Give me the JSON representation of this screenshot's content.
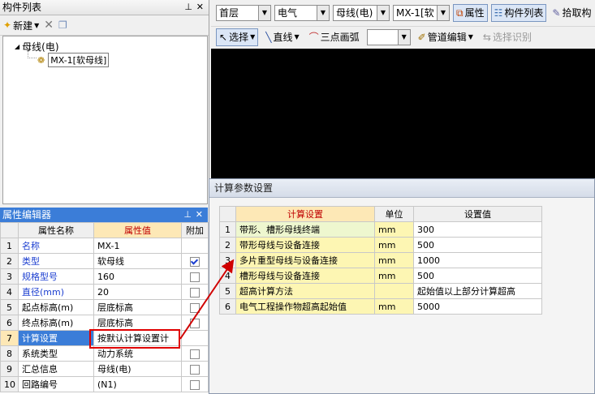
{
  "component_panel": {
    "title": "构件列表",
    "new_label": "新建",
    "tree_root": "母线(电)",
    "tree_child": "MX-1[软母线]"
  },
  "top_bar": {
    "floor": "首层",
    "specialty": "电气",
    "type": "母线(电)",
    "component": "MX-1[软",
    "properties_label": "属性",
    "component_list_label": "构件列表",
    "pick_label": "拾取构",
    "select_label": "选择",
    "line_label": "直线",
    "arc_label": "三点画弧",
    "pipe_edit_label": "管道编辑",
    "select_identify_label": "选择识别"
  },
  "property_editor": {
    "title": "属性编辑器",
    "headers": {
      "name": "属性名称",
      "value": "属性值",
      "extra": "附加"
    },
    "rows": [
      {
        "num": "1",
        "name": "名称",
        "value": "MX-1",
        "blue": true,
        "check": "none"
      },
      {
        "num": "2",
        "name": "类型",
        "value": "软母线",
        "blue": true,
        "check": "on"
      },
      {
        "num": "3",
        "name": "规格型号",
        "value": "160",
        "blue": true,
        "check": "off"
      },
      {
        "num": "4",
        "name": "直径(mm)",
        "value": "20",
        "blue": true,
        "check": "off"
      },
      {
        "num": "5",
        "name": "起点标高(m)",
        "value": "层底标高",
        "blue": false,
        "check": "off"
      },
      {
        "num": "6",
        "name": "终点标高(m)",
        "value": "层底标高",
        "blue": false,
        "check": "off"
      },
      {
        "num": "7",
        "name": "计算设置",
        "value": "按默认计算设置计",
        "blue": false,
        "check": "none"
      },
      {
        "num": "8",
        "name": "系统类型",
        "value": "动力系统",
        "blue": false,
        "check": "off"
      },
      {
        "num": "9",
        "name": "汇总信息",
        "value": "母线(电)",
        "blue": false,
        "check": "off"
      },
      {
        "num": "10",
        "name": "回路编号",
        "value": "(N1)",
        "blue": false,
        "check": "off"
      }
    ]
  },
  "dialog": {
    "title": "计算参数设置",
    "headers": {
      "setting": "计算设置",
      "unit": "单位",
      "value": "设置值"
    },
    "rows": [
      {
        "num": "1",
        "setting": "带形、槽形母线终端",
        "unit": "mm",
        "value": "300"
      },
      {
        "num": "2",
        "setting": "带形母线与设备连接",
        "unit": "mm",
        "value": "500"
      },
      {
        "num": "3",
        "setting": "多片重型母线与设备连接",
        "unit": "mm",
        "value": "1000"
      },
      {
        "num": "4",
        "setting": "槽形母线与设备连接",
        "unit": "mm",
        "value": "500"
      },
      {
        "num": "5",
        "setting": "超高计算方法",
        "unit": "",
        "value": "起始值以上部分计算超高"
      },
      {
        "num": "6",
        "setting": "电气工程操作物超高起始值",
        "unit": "mm",
        "value": "5000"
      }
    ]
  },
  "colors": {
    "editor_title": "#3b7dd8",
    "annotation": "#d00000",
    "canvas": "#000000"
  }
}
